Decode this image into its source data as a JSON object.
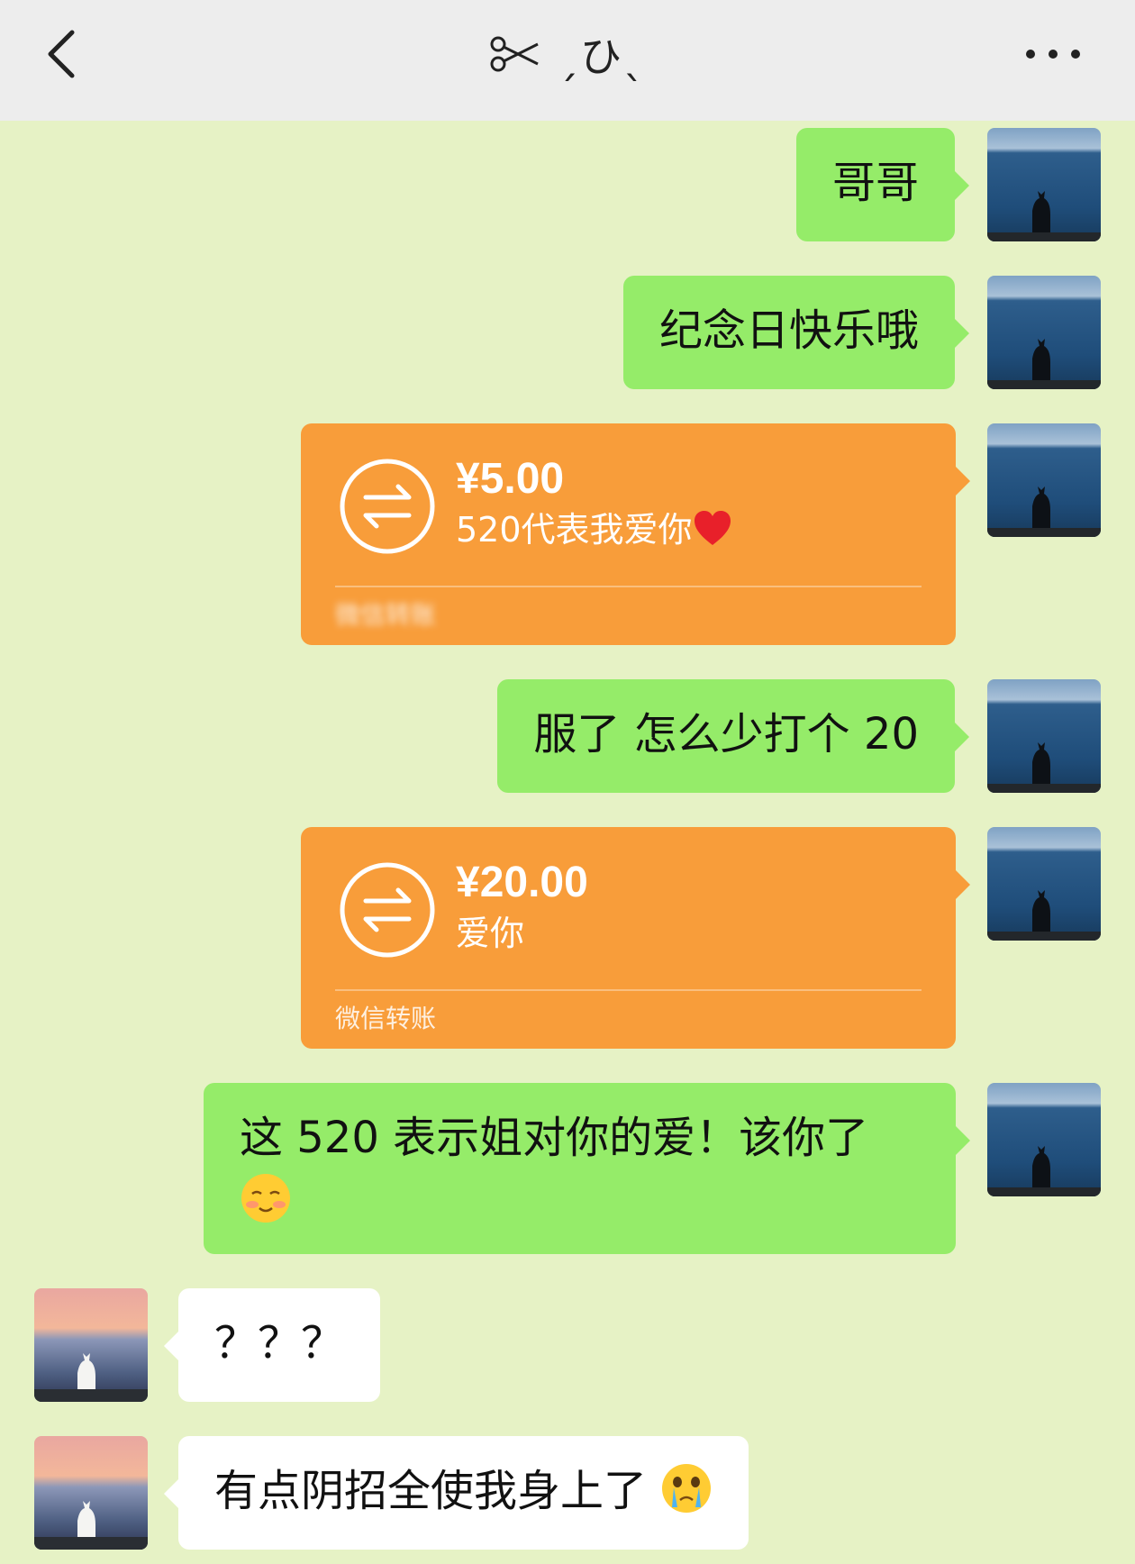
{
  "header": {
    "title": "૏⁀૏ ✂ ˎひˎ",
    "title_text": "ˏひˎ",
    "back_icon": "chevron-left-icon",
    "scissors_icon": "scissors-icon",
    "more_icon": "more-dots-icon",
    "background": "#EDEDED"
  },
  "colors": {
    "chat_background": "#E6F2C5",
    "my_bubble": "#95EC69",
    "other_bubble": "#FFFFFF",
    "transfer_card": "#F89D3A"
  },
  "messages": [
    {
      "sender": "me",
      "type": "text",
      "text": "哥哥"
    },
    {
      "sender": "me",
      "type": "text",
      "text": "纪念日快乐哦"
    },
    {
      "sender": "me",
      "type": "transfer",
      "amount": "¥5.00",
      "note": "520代表我爱你",
      "note_emoji": "red-heart",
      "footer": "微信转账"
    },
    {
      "sender": "me",
      "type": "text",
      "text": "服了 怎么少打个 20"
    },
    {
      "sender": "me",
      "type": "transfer",
      "amount": "¥20.00",
      "note": "爱你",
      "footer": "微信转账"
    },
    {
      "sender": "me",
      "type": "text",
      "text": "这 520 表示姐对你的爱！该你了",
      "emoji": "shy-smile-emoji"
    },
    {
      "sender": "other",
      "type": "text",
      "text": "？？？"
    },
    {
      "sender": "other",
      "type": "text",
      "text": "有点阴招全使我身上了",
      "emoji": "crying-emoji"
    }
  ]
}
